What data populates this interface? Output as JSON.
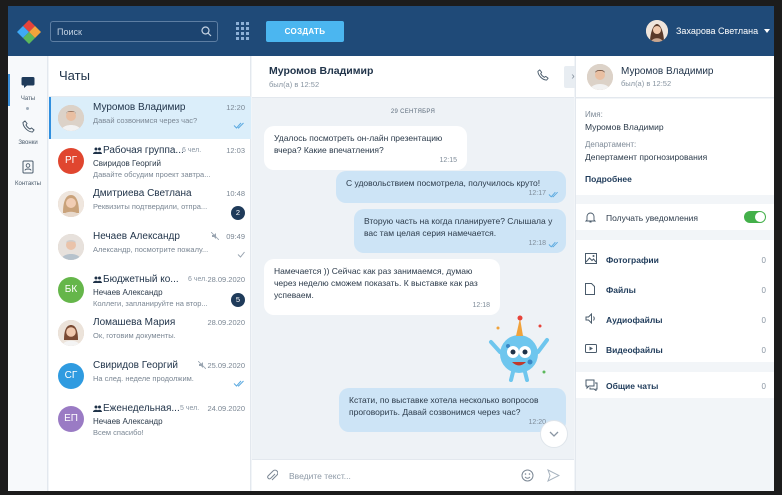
{
  "topbar": {
    "search_placeholder": "Поиск",
    "create_label": "СОЗДАТЬ",
    "user_name": "Захарова Светлана"
  },
  "rail": {
    "items": [
      {
        "label": "Чаты",
        "icon": "chat-icon"
      },
      {
        "label": "Звонки",
        "icon": "phone-icon"
      },
      {
        "label": "Контакты",
        "icon": "contacts-icon"
      }
    ]
  },
  "chats": {
    "title": "Чаты",
    "items": [
      {
        "name": "Муромов Владимир",
        "time": "12:20",
        "snippet": "Давай созвонимся через час?",
        "avatar": "photo",
        "check": true
      },
      {
        "name": "Рабочая группа...",
        "members": "6 чел.",
        "time": "12:03",
        "sender": "Свиридов Георгий",
        "snippet": "Давайте обсудим проект завтра...",
        "initials": "РГ",
        "color": "#e0462f"
      },
      {
        "name": "Дмитриева Светлана",
        "time": "10:48",
        "snippet": "Реквизиты подтвердили, отпра...",
        "avatar": "photo",
        "badge": "2"
      },
      {
        "name": "Нечаев Александр",
        "time": "09:49",
        "snippet": "Александр, посмотрите пожалу...",
        "avatar": "photo",
        "muted": true
      },
      {
        "name": "Бюджетный ко...",
        "members": "6 чел.",
        "time": "28.09.2020",
        "sender": "Нечаев Александр",
        "snippet": "Коллеги, запланируйте на втор...",
        "initials": "БК",
        "color": "#65b64a",
        "badge": "5"
      },
      {
        "name": "Ломашева Мария",
        "time": "28.09.2020",
        "snippet": "Ок, готовим документы.",
        "avatar": "photo"
      },
      {
        "name": "Свиридов Георгий",
        "time": "25.09.2020",
        "snippet": "На след. неделе продолжим.",
        "initials": "СГ",
        "color": "#2f9be0",
        "check": true,
        "muted": true
      },
      {
        "name": "Еженедельная...",
        "members": "5 чел.",
        "time": "24.09.2020",
        "sender": "Нечаев Александр",
        "snippet": "Всем спасибо!",
        "initials": "ЕП",
        "color": "#9a7bc4"
      }
    ]
  },
  "conversation": {
    "name": "Муромов Владимир",
    "seen": "был(а) в 12:52",
    "date": "29 СЕНТЯБРЯ",
    "messages": [
      {
        "dir": "in",
        "text": "Удалось посмотреть он-лайн презентацию вчера? Какие впечатления?",
        "time": "12:15"
      },
      {
        "dir": "out",
        "text": "С удовольствием посмотрела, получилось круто!",
        "time": "12:17"
      },
      {
        "dir": "out",
        "text": "Вторую часть на когда планируете? Слышала у вас там целая серия намечается.",
        "time": "12:18"
      },
      {
        "dir": "in",
        "text": "Намечается )) Сейчас как раз занимаемся, думаю через неделю сможем показать. К выставке как раз успеваем.",
        "time": "12:18"
      },
      {
        "dir": "out",
        "text": "Кстати, по выставке хотела несколько вопросов проговорить. Давай созвонимся через час?",
        "time": "12:20"
      }
    ],
    "composer_placeholder": "Введите текст..."
  },
  "panel": {
    "name": "Муромов Владимир",
    "seen": "был(а) в 12:52",
    "fields": [
      {
        "label": "Имя:",
        "value": "Муромов Владимир"
      },
      {
        "label": "Департамент:",
        "value": "Депертамент прогнозирования"
      }
    ],
    "more": "Подробнее",
    "notifications": "Получать уведомления",
    "notifications_on": true,
    "media": [
      {
        "label": "Фотографии",
        "count": "0",
        "icon": "photo-icon"
      },
      {
        "label": "Файлы",
        "count": "0",
        "icon": "file-icon"
      },
      {
        "label": "Аудиофайлы",
        "count": "0",
        "icon": "audio-icon"
      },
      {
        "label": "Видеофайлы",
        "count": "0",
        "icon": "video-icon"
      }
    ],
    "common_chats": {
      "label": "Общие чаты",
      "count": "0"
    }
  },
  "colors": {
    "topbar": "#1f4a78",
    "accent": "#4bb6f0",
    "active_item": "#dbeefa",
    "outgoing_bubble": "#cde4f6",
    "toggle_on": "#43b04a"
  }
}
